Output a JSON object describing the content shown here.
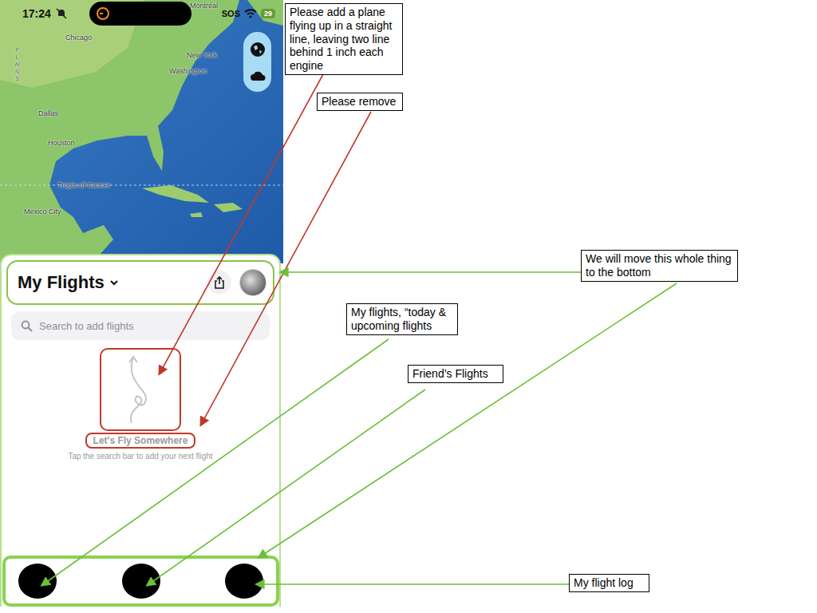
{
  "status_bar": {
    "time": "17:24",
    "network": "SOS",
    "battery": "29"
  },
  "map": {
    "labels": [
      "Montréal",
      "Chicago",
      "New York",
      "Washington",
      "Dallas",
      "Houston",
      "Mexico City",
      "Tropic of Cancer",
      "PLAINS"
    ]
  },
  "sheet": {
    "title": "My Flights",
    "search_placeholder": "Search to add flights",
    "empty_title": "Let's Fly Somewhere",
    "empty_subtitle": "Tap the search bar to add your next flight"
  },
  "tab_bar": {
    "tabs": [
      {},
      {},
      {}
    ]
  },
  "annotations": [
    {
      "text": "Please add a plane flying up in a straight line, leaving two line behind 1 inch each engine",
      "color": "#c0392b"
    },
    {
      "text": "Please remove",
      "color": "#c0392b"
    },
    {
      "text": "We will move this whole thing to the bottom",
      "color": "#6cbf3a"
    },
    {
      "text": "My flights, “today & upcoming flights",
      "color": "#6cbf3a"
    },
    {
      "text": "Friend’s Flights",
      "color": "#6cbf3a"
    },
    {
      "text": "My flight log",
      "color": "#6cbf3a"
    }
  ]
}
